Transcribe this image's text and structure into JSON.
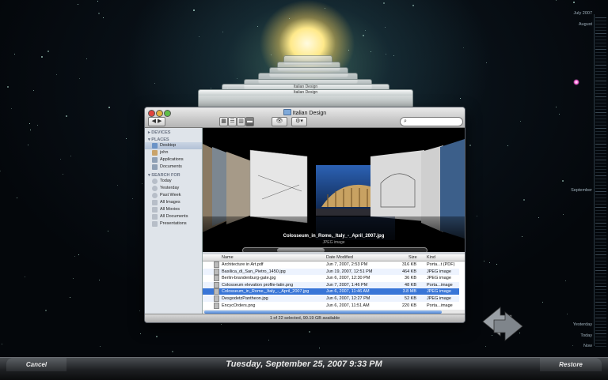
{
  "window": {
    "title": "Italian Design",
    "search_placeholder": "",
    "view_modes": [
      "icon",
      "list",
      "column",
      "coverflow"
    ]
  },
  "sidebar": {
    "devices_label": "DEVICES",
    "places_label": "PLACES",
    "places": [
      "Desktop",
      "john",
      "Applications",
      "Documents"
    ],
    "search_label": "SEARCH FOR",
    "searches": [
      "Today",
      "Yesterday",
      "Past Week",
      "All Images",
      "All Movies",
      "All Documents",
      "Presentations"
    ]
  },
  "coverflow": {
    "current_name": "Colosseum_in_Rome,_Italy_-_April_2007.jpg",
    "current_kind": "JPEG image"
  },
  "list": {
    "headers": {
      "name": "Name",
      "date": "Date Modified",
      "size": "Size",
      "kind": "Kind"
    },
    "rows": [
      {
        "name": "Architecture in Art.pdf",
        "date": "Jun 7, 2007, 2:53 PM",
        "size": "316 KB",
        "kind": "Porta...t (PDF)"
      },
      {
        "name": "Basilica_di_San_Pietro_1450.jpg",
        "date": "Jun 19, 2007, 12:51 PM",
        "size": "464 KB",
        "kind": "JPEG image"
      },
      {
        "name": "Berlin-brandenburg-gate.jpg",
        "date": "Jun 6, 2007, 12:30 PM",
        "size": "36 KB",
        "kind": "JPEG image"
      },
      {
        "name": "Colosseum elevation profile-latin.png",
        "date": "Jun 7, 2007, 1:46 PM",
        "size": "48 KB",
        "kind": "Porta...image"
      },
      {
        "name": "Colosseum_in_Rome,_Italy_-_April_2007.jpg",
        "date": "Jun 6, 2007, 11:46 AM",
        "size": "3.8 MB",
        "kind": "JPEG image"
      },
      {
        "name": "DesgodetzPantheon.jpg",
        "date": "Jun 6, 2007, 12:27 PM",
        "size": "52 KB",
        "kind": "JPEG image"
      },
      {
        "name": "EncycOrders.png",
        "date": "Jun 6, 2007, 11:51 AM",
        "size": "220 KB",
        "kind": "Porta...image"
      }
    ],
    "selected_index": 4
  },
  "status": {
    "text": "1 of 22 selected, 90.19 GB available"
  },
  "backwin": {
    "title": "Italian Design"
  },
  "timeline": {
    "labels": [
      {
        "text": "July 2007"
      },
      {
        "text": "August"
      },
      {
        "text": "September"
      },
      {
        "text": "Yesterday"
      },
      {
        "text": "Today"
      },
      {
        "text": "Now"
      }
    ]
  },
  "bottom": {
    "cancel_label": "Cancel",
    "date_label": "Tuesday, September 25, 2007 9:33 PM",
    "restore_label": "Restore"
  },
  "colors": {
    "accent": "#3875d7",
    "selection": "#3875d7"
  }
}
